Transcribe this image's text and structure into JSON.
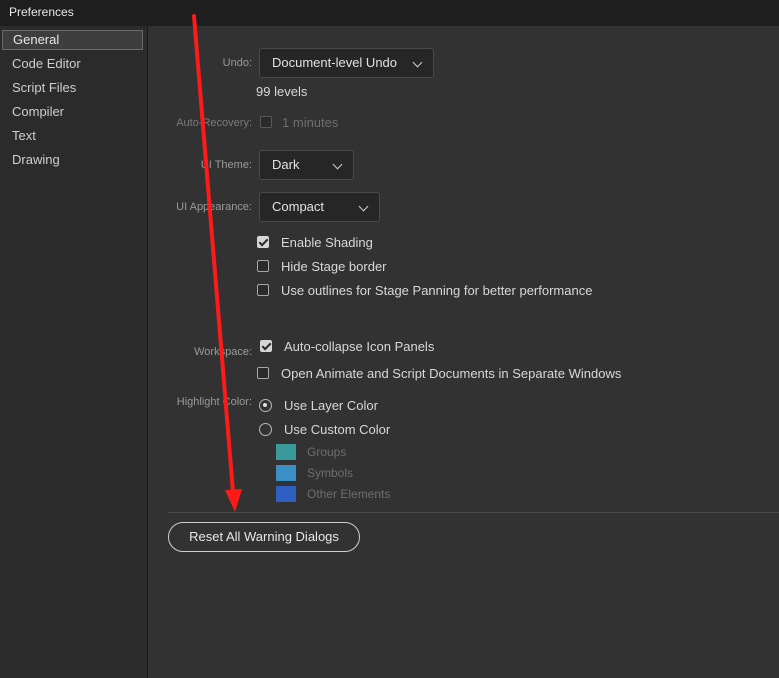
{
  "window": {
    "title": "Preferences"
  },
  "sidebar": {
    "items": [
      {
        "label": "General",
        "active": true
      },
      {
        "label": "Code Editor"
      },
      {
        "label": "Script Files"
      },
      {
        "label": "Compiler"
      },
      {
        "label": "Text"
      },
      {
        "label": "Drawing"
      }
    ]
  },
  "general": {
    "undo": {
      "label": "Undo:",
      "value": "Document-level Undo",
      "levels_value": "99",
      "levels_unit": "levels"
    },
    "auto_recovery": {
      "label": "Auto-Recovery:",
      "value": "1",
      "unit": "minutes",
      "checked": false
    },
    "ui_theme": {
      "label": "UI Theme:",
      "value": "Dark"
    },
    "ui_appearance": {
      "label": "UI Appearance:",
      "value": "Compact"
    },
    "appearance_options": [
      {
        "label": "Enable Shading",
        "checked": true
      },
      {
        "label": "Hide Stage border",
        "checked": false
      },
      {
        "label": "Use outlines for Stage Panning for better performance",
        "checked": false
      }
    ],
    "workspace": {
      "label": "Workspace:",
      "options": [
        {
          "label": "Auto-collapse Icon Panels",
          "checked": true
        },
        {
          "label": "Open Animate and Script Documents in Separate Windows",
          "checked": false
        }
      ]
    },
    "highlight_color": {
      "label": "Highlight Color:",
      "options": [
        {
          "label": "Use Layer Color",
          "selected": true
        },
        {
          "label": "Use Custom Color",
          "selected": false
        }
      ],
      "swatches": [
        {
          "label": "Groups",
          "color": "#3a9a9a"
        },
        {
          "label": "Symbols",
          "color": "#3a8fc4"
        },
        {
          "label": "Other Elements",
          "color": "#2f5fc0"
        }
      ]
    },
    "reset_button": "Reset All Warning Dialogs"
  },
  "annotation": {
    "arrow_color": "#ff1a1a"
  }
}
